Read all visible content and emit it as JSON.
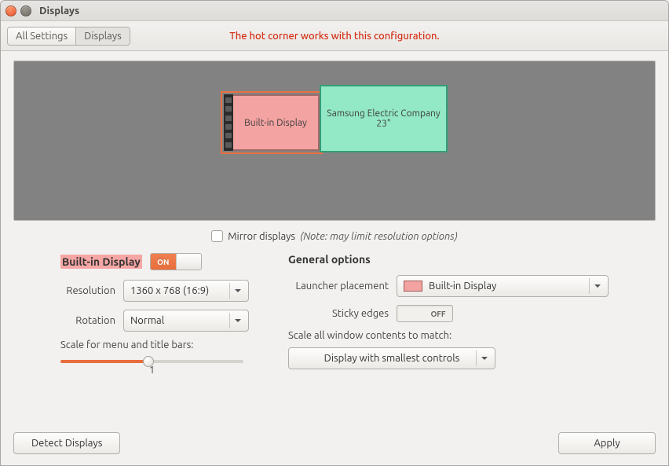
{
  "window": {
    "title": "Displays"
  },
  "toolbar": {
    "all_settings": "All Settings",
    "displays": "Displays",
    "warning": "The hot corner works with this configuration."
  },
  "arrangement": {
    "monitor1": "Built-in Display",
    "monitor2": "Samsung Electric Company  23\""
  },
  "mirror": {
    "label": "Mirror displays",
    "note": "(Note: may limit resolution options)"
  },
  "left": {
    "heading": "Built-in Display",
    "toggle_on": "ON",
    "resolution_label": "Resolution",
    "resolution_value": "1360 x 768 (16:9)",
    "rotation_label": "Rotation",
    "rotation_value": "Normal",
    "scale_label": "Scale for menu and title bars:",
    "scale_value": "1"
  },
  "right": {
    "heading": "General options",
    "launcher_label": "Launcher placement",
    "launcher_value": "Built-in Display",
    "sticky_label": "Sticky edges",
    "sticky_value": "OFF",
    "scale_all_label": "Scale all window contents to match:",
    "scale_all_value": "Display with smallest controls"
  },
  "footer": {
    "detect": "Detect Displays",
    "apply": "Apply"
  }
}
